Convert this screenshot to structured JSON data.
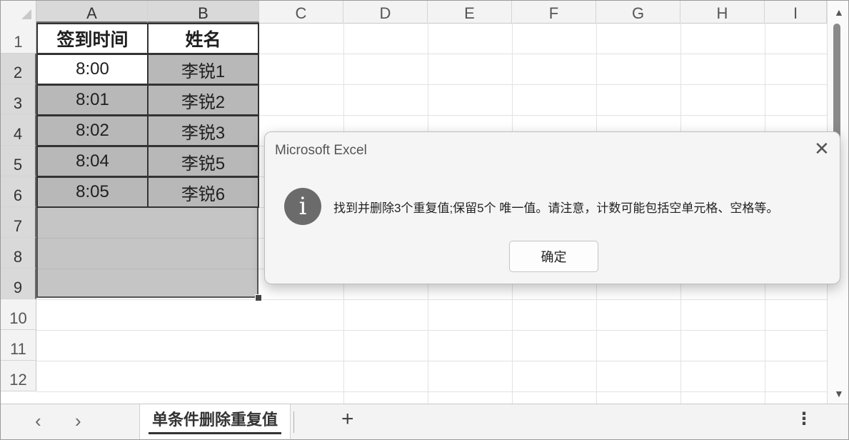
{
  "columns": [
    "A",
    "B",
    "C",
    "D",
    "E",
    "F",
    "G",
    "H",
    "I"
  ],
  "rows": [
    "1",
    "2",
    "3",
    "4",
    "5",
    "6",
    "7",
    "8",
    "9",
    "10",
    "11",
    "12"
  ],
  "table": {
    "headers": [
      "签到时间",
      "姓名"
    ],
    "rows": [
      {
        "time": "8:00",
        "name": "李锐1"
      },
      {
        "time": "8:01",
        "name": "李锐2"
      },
      {
        "time": "8:02",
        "name": "李锐3"
      },
      {
        "time": "8:04",
        "name": "李锐5"
      },
      {
        "time": "8:05",
        "name": "李锐6"
      }
    ]
  },
  "dialog": {
    "title": "Microsoft Excel",
    "icon": "info-icon",
    "icon_glyph": "i",
    "message": "找到并删除3个重复值;保留5个 唯一值。请注意，计数可能包括空单元格、空格等。",
    "ok_label": "确定",
    "close_glyph": "✕"
  },
  "tabs": {
    "prev_glyph": "‹",
    "next_glyph": "›",
    "active_sheet": "单条件删除重复值",
    "add_glyph": "+",
    "more_glyph": "⋮"
  },
  "scrollbar": {
    "up_glyph": "▲",
    "down_glyph": "▼"
  }
}
